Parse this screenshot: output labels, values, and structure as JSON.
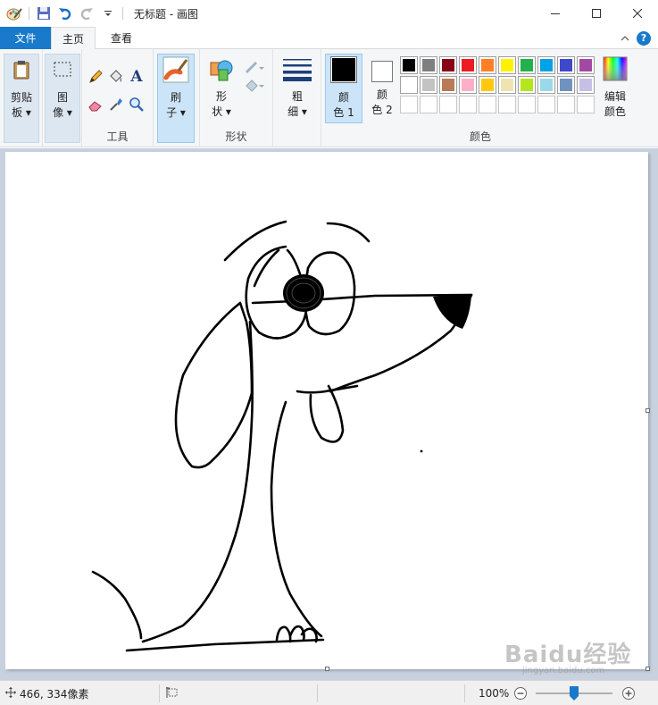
{
  "window": {
    "title": "无标题 - 画图"
  },
  "tabs": {
    "file": "文件",
    "home": "主页",
    "view": "查看"
  },
  "ribbon": {
    "clipboard": {
      "line1": "剪贴",
      "line2": "板"
    },
    "image": {
      "line1": "图",
      "line2": "像"
    },
    "tools_label": "工具",
    "brushes": {
      "line1": "刷",
      "line2": "子"
    },
    "shapes": {
      "line1": "形",
      "line2": "状",
      "group_label": "形状"
    },
    "size": {
      "line1": "粗",
      "line2": "细"
    },
    "color1": {
      "line1": "颜",
      "line2": "色 1"
    },
    "color2": {
      "line1": "颜",
      "line2": "色 2"
    },
    "edit_colors": {
      "line1": "编辑",
      "line2": "颜色"
    },
    "colors_label": "颜色",
    "color1_value": "#000000",
    "color2_value": "#ffffff"
  },
  "palette": {
    "row1": [
      "#000000",
      "#7f7f7f",
      "#880015",
      "#ed1c24",
      "#ff7f27",
      "#fff200",
      "#22b14c",
      "#00a2e8",
      "#3f48cc",
      "#a349a4"
    ],
    "row2": [
      "#ffffff",
      "#c3c3c3",
      "#b97a57",
      "#ffaec9",
      "#ffc90e",
      "#efe4b0",
      "#b5e61d",
      "#99d9ea",
      "#7092be",
      "#c8bfe7"
    ],
    "row3": [
      "#ffffff",
      "#ffffff",
      "#ffffff",
      "#ffffff",
      "#ffffff",
      "#ffffff",
      "#ffffff",
      "#ffffff",
      "#ffffff",
      "#ffffff"
    ]
  },
  "status": {
    "cursor_pos": "466, 334像素",
    "zoom": "100%"
  },
  "watermark": {
    "big": "Baidu经验",
    "small": "jingyan.baidu.com"
  }
}
